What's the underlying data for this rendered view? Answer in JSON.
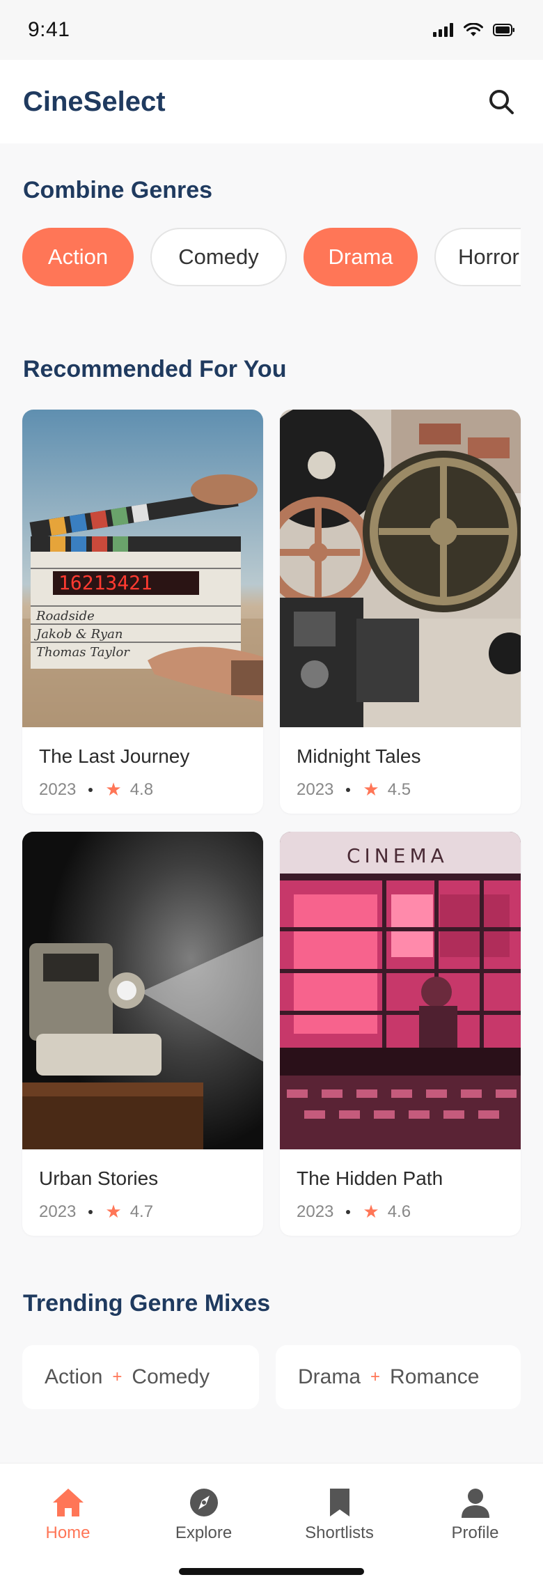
{
  "status_bar": {
    "time": "9:41"
  },
  "header": {
    "title": "CineSelect"
  },
  "genres": {
    "title": "Combine Genres",
    "chips": [
      {
        "label": "Action",
        "active": true
      },
      {
        "label": "Comedy",
        "active": false
      },
      {
        "label": "Drama",
        "active": true
      },
      {
        "label": "Horror",
        "active": false
      }
    ]
  },
  "recommended": {
    "title": "Recommended For You",
    "movies": [
      {
        "title": "The Last Journey",
        "year": "2023",
        "rating": "4.8",
        "poster": "clapperboard-image"
      },
      {
        "title": "Midnight Tales",
        "year": "2023",
        "rating": "4.5",
        "poster": "film-projector-reels-image"
      },
      {
        "title": "Urban Stories",
        "year": "2023",
        "rating": "4.7",
        "poster": "projector-beam-image"
      },
      {
        "title": "The Hidden Path",
        "year": "2023",
        "rating": "4.6",
        "poster": "cinema-facade-image"
      }
    ],
    "clapperboard_text": {
      "timecode": "16213421",
      "row1": "Roadside",
      "row2": "Jakob & Ryan",
      "row3": "Thomas Taylor"
    },
    "cinema_sign": "CINEMA"
  },
  "trending": {
    "title": "Trending Genre Mixes",
    "mixes": [
      {
        "a": "Action",
        "b": "Comedy"
      },
      {
        "a": "Drama",
        "b": "Romance"
      }
    ],
    "separator": "+"
  },
  "nav": {
    "items": [
      {
        "label": "Home",
        "icon": "home-icon",
        "active": true
      },
      {
        "label": "Explore",
        "icon": "compass-icon",
        "active": false
      },
      {
        "label": "Shortlists",
        "icon": "bookmark-icon",
        "active": false
      },
      {
        "label": "Profile",
        "icon": "user-icon",
        "active": false
      }
    ]
  },
  "colors": {
    "accent": "#ff7657",
    "heading": "#1f3a5f",
    "background": "#f8f8f9"
  }
}
